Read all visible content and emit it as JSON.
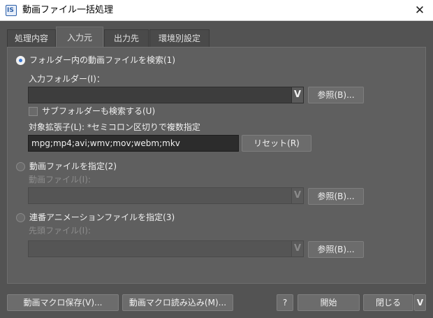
{
  "window": {
    "icon_text": "IS",
    "title": "動画ファイル一括処理"
  },
  "tabs": [
    {
      "label": "処理内容"
    },
    {
      "label": "入力元"
    },
    {
      "label": "出力先"
    },
    {
      "label": "環境別設定"
    }
  ],
  "input": {
    "folder_option": "フォルダー内の動画ファイルを検索(1)",
    "folder_label": "入力フォルダー(I)：",
    "browse_label": "参照(B)...",
    "subfolder_label": "サブフォルダーも検索する(U)",
    "ext_label": "対象拡張子(L): *セミコロン区切りで複数指定",
    "ext_value": "mpg;mp4;avi;wmv;mov;webm;mkv",
    "reset_label": "リセット(R)",
    "file_option": "動画ファイルを指定(2)",
    "file_label": "動画ファイル(I):",
    "seq_option": "連番アニメーションファイルを指定(3)",
    "seq_label": "先頭ファイル(I):",
    "combo_glyph": "V"
  },
  "footer": {
    "save_macro": "動画マクロ保存(V)...",
    "load_macro": "動画マクロ読み込み(M)...",
    "help": "?",
    "start": "開始",
    "close": "閉じる",
    "more_glyph": "V"
  }
}
